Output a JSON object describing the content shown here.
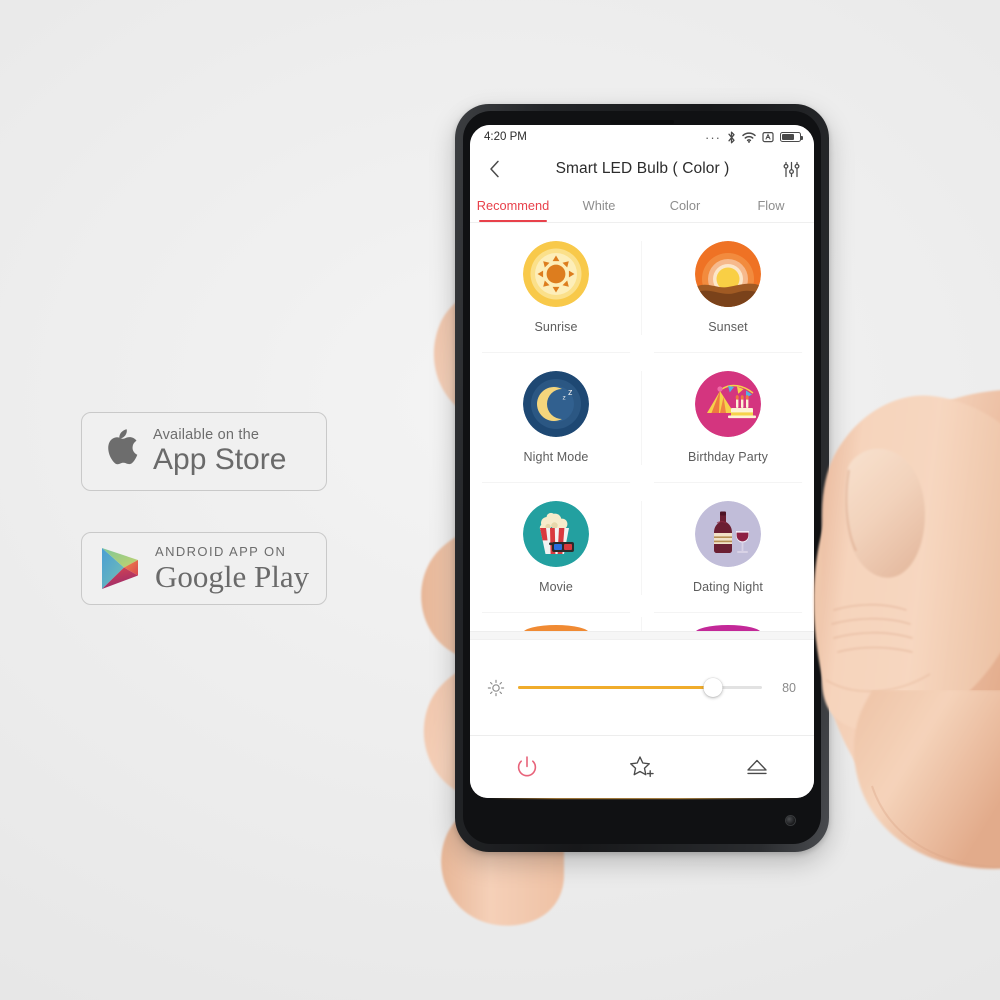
{
  "scene": {
    "background_color": "#efefef"
  },
  "badges": [
    {
      "name": "app-store",
      "icon": "apple-logo-icon",
      "top_line": "Available on the",
      "bottom_line": "App Store"
    },
    {
      "name": "google-play",
      "icon": "google-play-triangle-icon",
      "top_line": "ANDROID APP ON",
      "bottom_line": "Google Play"
    }
  ],
  "phone": {
    "frame_color": "#1b1c1e",
    "statusbar": {
      "time": "4:20 PM",
      "icons": [
        "more-dots-icon",
        "bluetooth-icon",
        "wifi-icon",
        "alarm-icon",
        "battery-icon"
      ],
      "battery_level_pct": 72
    },
    "appbar": {
      "back_icon": "chevron-left-icon",
      "title": "Smart LED Bulb ( Color )",
      "settings_icon": "sliders-icon"
    },
    "tabs": [
      {
        "label": "Recommend",
        "active": true
      },
      {
        "label": "White",
        "active": false
      },
      {
        "label": "Color",
        "active": false
      },
      {
        "label": "Flow",
        "active": false
      }
    ],
    "accent_color": "#e8414b",
    "scenes": [
      {
        "label": "Sunrise",
        "icon": "sunrise-icon",
        "color": "#f6c244"
      },
      {
        "label": "Sunset",
        "icon": "sunset-icon",
        "color": "#ef7a2a"
      },
      {
        "label": "Night Mode",
        "icon": "night-mode-icon",
        "color": "#1f4770"
      },
      {
        "label": "Birthday Party",
        "icon": "birthday-party-icon",
        "color": "#d4357f"
      },
      {
        "label": "Movie",
        "icon": "movie-icon",
        "color": "#23a0a0"
      },
      {
        "label": "Dating Night",
        "icon": "dating-night-icon",
        "color": "#c0bcd8"
      }
    ],
    "scenes_partial_row": [
      {
        "icon": "partial-orange-icon",
        "color": "#f08a33"
      },
      {
        "icon": "partial-magenta-icon",
        "color": "#c32898"
      }
    ],
    "brightness": {
      "icon": "brightness-sun-icon",
      "value": "80",
      "percent": 80,
      "fill_color": "#f0ac2b"
    },
    "toolbar": [
      {
        "name": "power-button",
        "icon": "power-icon",
        "color": "#e8637a"
      },
      {
        "name": "favorite-button",
        "icon": "star-plus-icon",
        "color": "#4a4a4a"
      },
      {
        "name": "share-button",
        "icon": "eject-icon",
        "color": "#4a4a4a"
      }
    ]
  }
}
